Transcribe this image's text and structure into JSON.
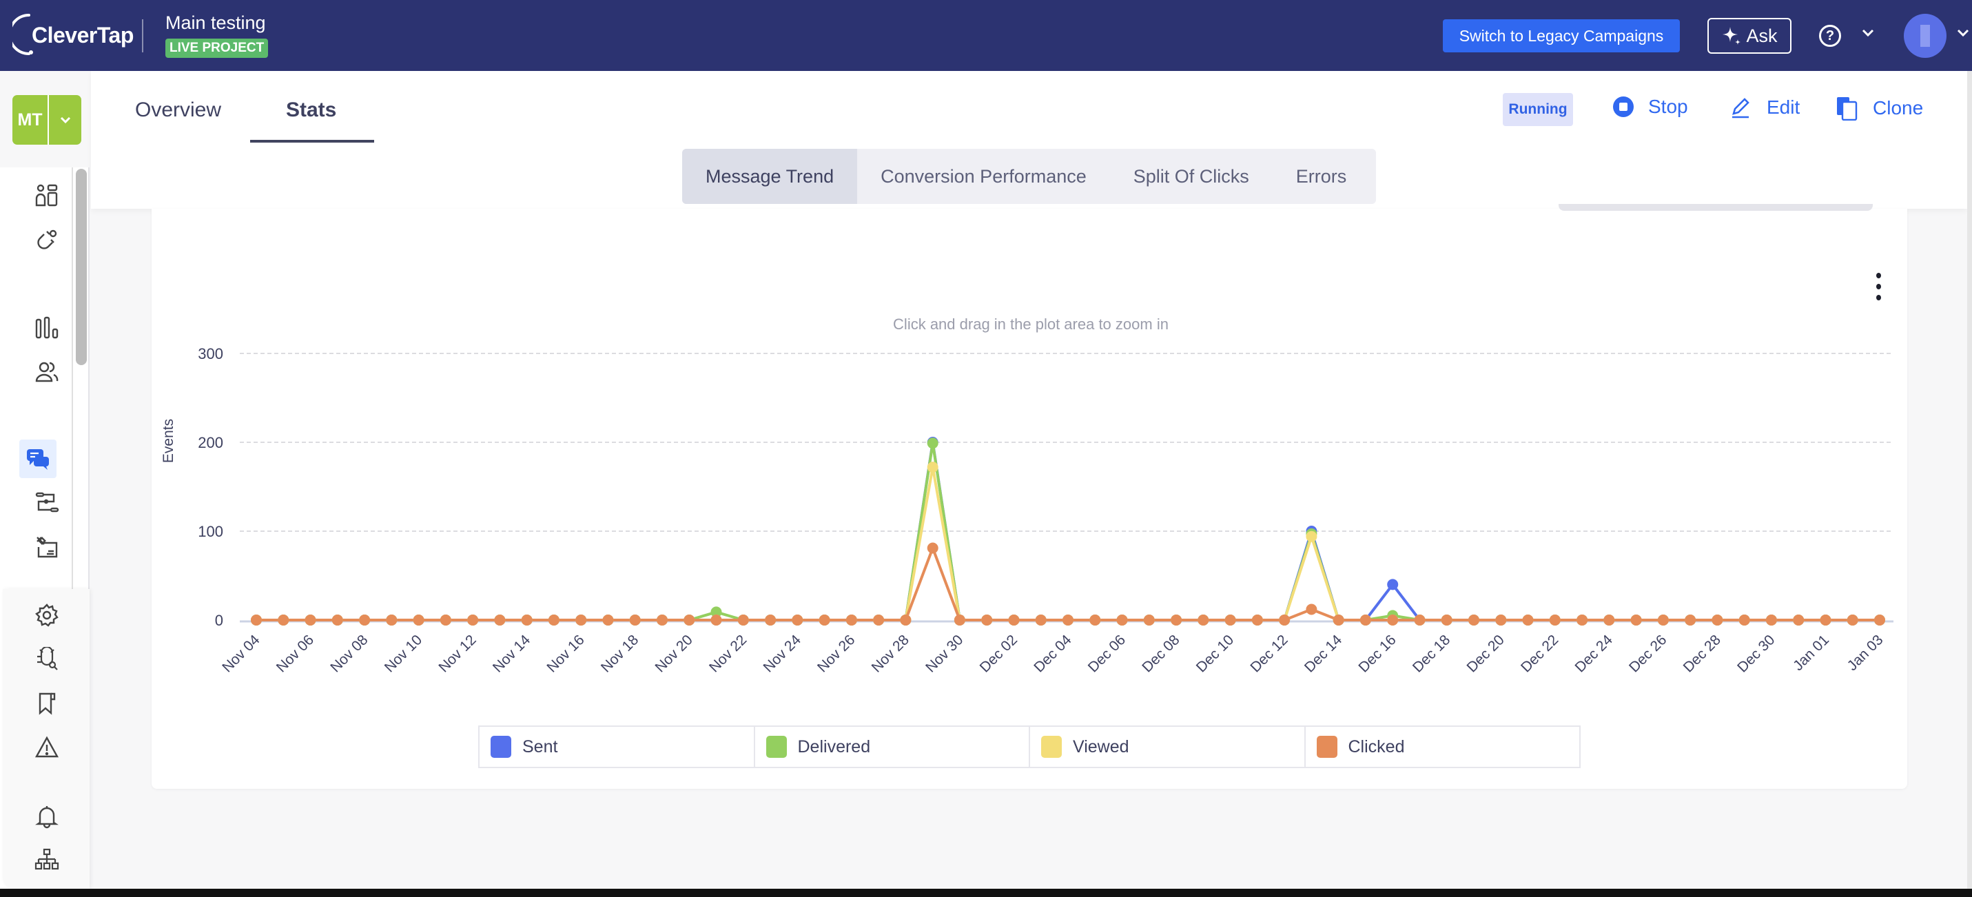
{
  "header": {
    "logo_text": "CleverTap",
    "project_name": "Main testing",
    "project_badge": "LIVE PROJECT",
    "legacy_button": "Switch to Legacy Campaigns",
    "ask_button": "Ask",
    "help_icon": "?"
  },
  "sidebar": {
    "project_initials": "MT",
    "items": [
      {
        "icon": "dashboard-icon"
      },
      {
        "icon": "magnet-icon"
      },
      {
        "icon": "analytics-bar-icon"
      },
      {
        "icon": "users-icon"
      },
      {
        "icon": "messages-icon",
        "active": true
      },
      {
        "icon": "journeys-icon"
      },
      {
        "icon": "catalog-icon"
      },
      {
        "icon": "settings-gear-icon"
      },
      {
        "icon": "debug-bug-icon"
      },
      {
        "icon": "bookmark-icon"
      },
      {
        "icon": "warning-icon"
      },
      {
        "icon": "notification-bell-icon"
      },
      {
        "icon": "org-hierarchy-icon"
      }
    ]
  },
  "page": {
    "tabs": [
      {
        "label": "Overview",
        "active": false
      },
      {
        "label": "Stats",
        "active": true
      }
    ],
    "status": "Running",
    "actions": {
      "stop": "Stop",
      "edit": "Edit",
      "clone": "Clone"
    },
    "subtabs": [
      {
        "label": "Message Trend",
        "active": true
      },
      {
        "label": "Conversion Performance",
        "active": false
      },
      {
        "label": "Split Of Clicks",
        "active": false
      },
      {
        "label": "Errors",
        "active": false
      }
    ],
    "accent_color": "#3068f0"
  },
  "chart_data": {
    "type": "line",
    "title": "",
    "subtitle": "Click and drag in the plot area to zoom in",
    "xlabel": "",
    "ylabel": "Events",
    "ylim": [
      0,
      300
    ],
    "yticks": [
      0,
      100,
      200,
      300
    ],
    "grid": true,
    "legend_position": "bottom",
    "x": [
      "Nov 04",
      "Nov 05",
      "Nov 06",
      "Nov 07",
      "Nov 08",
      "Nov 09",
      "Nov 10",
      "Nov 11",
      "Nov 12",
      "Nov 13",
      "Nov 14",
      "Nov 15",
      "Nov 16",
      "Nov 17",
      "Nov 18",
      "Nov 19",
      "Nov 20",
      "Nov 21",
      "Nov 22",
      "Nov 23",
      "Nov 24",
      "Nov 25",
      "Nov 26",
      "Nov 27",
      "Nov 28",
      "Nov 29",
      "Nov 30",
      "Dec 01",
      "Dec 02",
      "Dec 03",
      "Dec 04",
      "Dec 05",
      "Dec 06",
      "Dec 07",
      "Dec 08",
      "Dec 09",
      "Dec 10",
      "Dec 11",
      "Dec 12",
      "Dec 13",
      "Dec 14",
      "Dec 15",
      "Dec 16",
      "Dec 17",
      "Dec 18",
      "Dec 19",
      "Dec 20",
      "Dec 21",
      "Dec 22",
      "Dec 23",
      "Dec 24",
      "Dec 25",
      "Dec 26",
      "Dec 27",
      "Dec 28",
      "Dec 29",
      "Dec 30",
      "Dec 31",
      "Jan 01",
      "Jan 02",
      "Jan 03"
    ],
    "xtick_labels": [
      "Nov 04",
      "Nov 06",
      "Nov 08",
      "Nov 10",
      "Nov 12",
      "Nov 14",
      "Nov 16",
      "Nov 18",
      "Nov 20",
      "Nov 22",
      "Nov 24",
      "Nov 26",
      "Nov 28",
      "Nov 30",
      "Dec 02",
      "Dec 04",
      "Dec 06",
      "Dec 08",
      "Dec 10",
      "Dec 12",
      "Dec 14",
      "Dec 16",
      "Dec 18",
      "Dec 20",
      "Dec 22",
      "Dec 24",
      "Dec 26",
      "Dec 28",
      "Dec 30",
      "Jan 01",
      "Jan 03"
    ],
    "series": [
      {
        "name": "Sent",
        "color": "#5570ec",
        "values": [
          0,
          0,
          0,
          0,
          0,
          0,
          0,
          0,
          0,
          0,
          0,
          0,
          0,
          0,
          0,
          0,
          0,
          0,
          0,
          0,
          0,
          0,
          0,
          0,
          0,
          200,
          0,
          0,
          0,
          0,
          0,
          0,
          0,
          0,
          0,
          0,
          0,
          0,
          0,
          100,
          0,
          0,
          40,
          0,
          0,
          0,
          0,
          0,
          0,
          0,
          0,
          0,
          0,
          0,
          0,
          0,
          0,
          0,
          0,
          0,
          0
        ]
      },
      {
        "name": "Delivered",
        "color": "#94cf5f",
        "values": [
          0,
          0,
          0,
          0,
          0,
          0,
          0,
          0,
          0,
          0,
          0,
          0,
          0,
          0,
          0,
          0,
          0,
          9,
          0,
          0,
          0,
          0,
          0,
          0,
          0,
          199,
          0,
          0,
          0,
          0,
          0,
          0,
          0,
          0,
          0,
          0,
          0,
          0,
          0,
          97,
          0,
          0,
          5,
          0,
          0,
          0,
          0,
          0,
          0,
          0,
          0,
          0,
          0,
          0,
          0,
          0,
          0,
          0,
          0,
          0,
          0
        ]
      },
      {
        "name": "Viewed",
        "color": "#f3dd78",
        "values": [
          0,
          0,
          0,
          0,
          0,
          0,
          0,
          0,
          0,
          0,
          0,
          0,
          0,
          0,
          0,
          0,
          0,
          0,
          0,
          0,
          0,
          0,
          0,
          0,
          0,
          172,
          0,
          0,
          0,
          0,
          0,
          0,
          0,
          0,
          0,
          0,
          0,
          0,
          0,
          94,
          0,
          0,
          0,
          0,
          0,
          0,
          0,
          0,
          0,
          0,
          0,
          0,
          0,
          0,
          0,
          0,
          0,
          0,
          0,
          0,
          0
        ]
      },
      {
        "name": "Clicked",
        "color": "#e58c58",
        "values": [
          0,
          0,
          0,
          0,
          0,
          0,
          0,
          0,
          0,
          0,
          0,
          0,
          0,
          0,
          0,
          0,
          0,
          0,
          0,
          0,
          0,
          0,
          0,
          0,
          0,
          81,
          0,
          0,
          0,
          0,
          0,
          0,
          0,
          0,
          0,
          0,
          0,
          0,
          0,
          12,
          0,
          0,
          0,
          0,
          0,
          0,
          0,
          0,
          0,
          0,
          0,
          0,
          0,
          0,
          0,
          0,
          0,
          0,
          0,
          0,
          0
        ]
      }
    ]
  }
}
